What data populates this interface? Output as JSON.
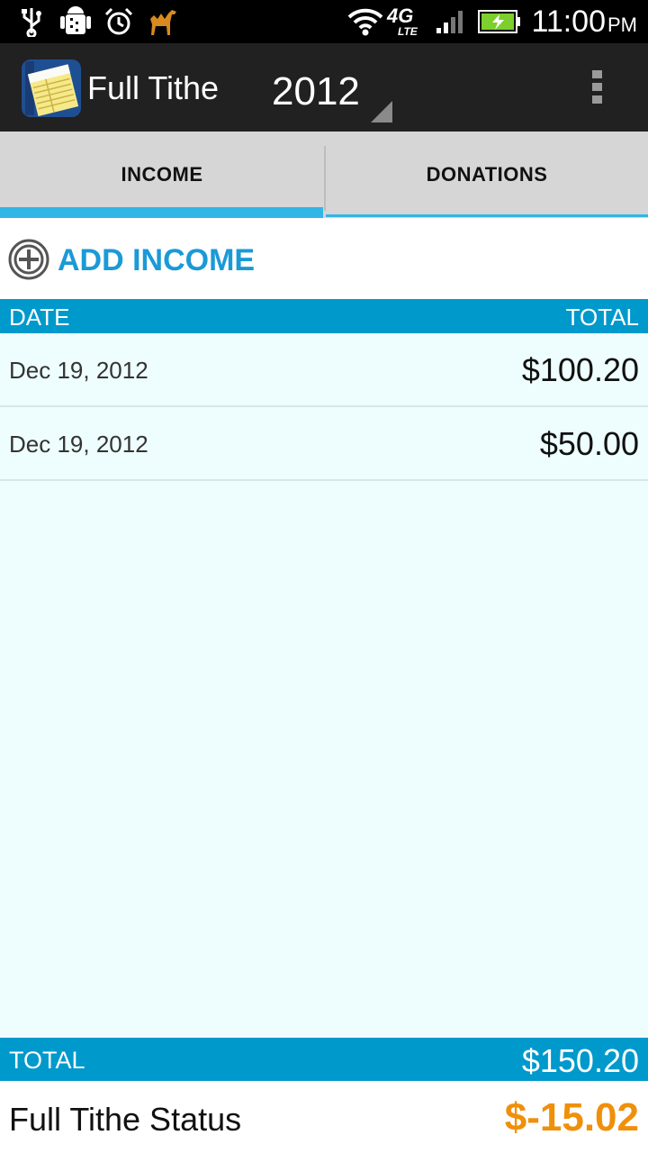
{
  "statusbar": {
    "icons": [
      "usb-icon",
      "android-debug-icon",
      "alarm-icon",
      "camel-app-icon",
      "wifi-icon",
      "4g-lte-icon",
      "signal-icon",
      "battery-charging-icon"
    ],
    "network_label": "4G",
    "network_sub": "LTE",
    "time": "11:00",
    "ampm": "PM"
  },
  "actionbar": {
    "app_title": "Full Tithe",
    "year": "2012",
    "overflow_icon": "overflow-menu-icon"
  },
  "tabs": [
    {
      "label": "INCOME",
      "selected": true
    },
    {
      "label": "DONATIONS",
      "selected": false
    }
  ],
  "add": {
    "label": "ADD INCOME",
    "icon": "add-circle-icon"
  },
  "table": {
    "headers": {
      "date": "DATE",
      "total": "TOTAL"
    },
    "rows": [
      {
        "date": "Dec 19, 2012",
        "amount": "$100.20"
      },
      {
        "date": "Dec 19, 2012",
        "amount": "$50.00"
      }
    ]
  },
  "footer": {
    "total_label": "TOTAL",
    "total_value": "$150.20",
    "status_label": "Full Tithe Status",
    "status_value": "$-15.02"
  },
  "colors": {
    "accent": "#33b5e5",
    "header_bg": "#0099cc",
    "add_text": "#1a9ad6",
    "status_value": "#f0900a",
    "list_bg": "#eefdfd"
  }
}
